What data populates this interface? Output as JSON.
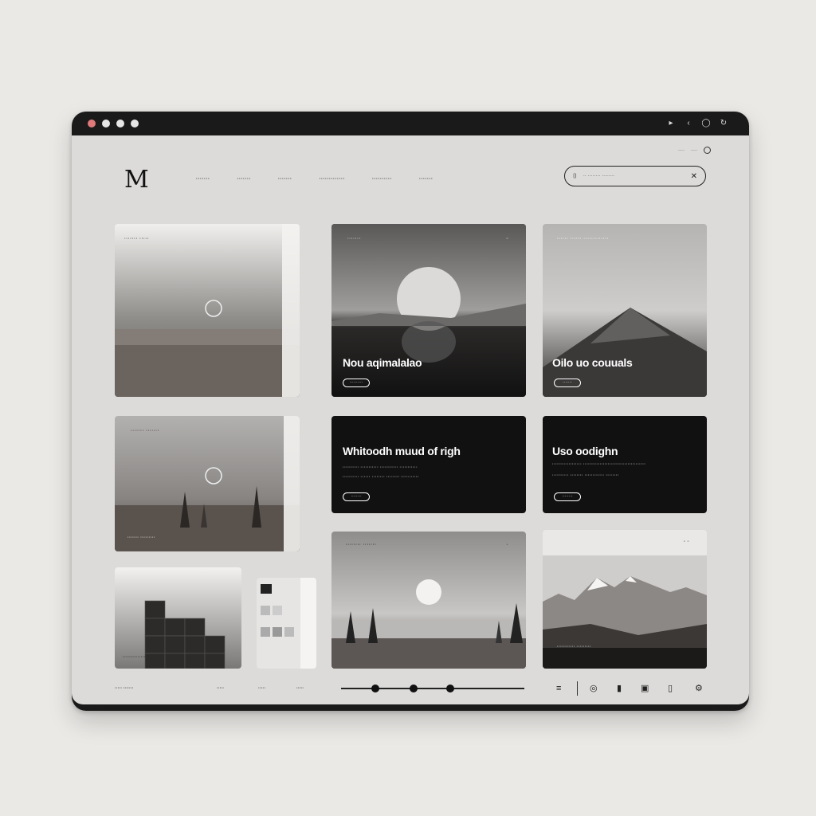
{
  "window": {
    "controls": [
      "close",
      "minimize",
      "maximize"
    ],
    "control_colors": [
      "#e07a7a",
      "#e8e8e8",
      "#e8e8e8"
    ],
    "toolbar_icons": [
      "chevron-icon",
      "back-icon",
      "circle-icon",
      "refresh-icon"
    ]
  },
  "header": {
    "logo": "M",
    "utility": {
      "item1": "····",
      "item2": "····",
      "icon": "info-icon"
    },
    "nav": [
      "·······",
      "·······",
      "·······",
      "·············",
      "··········",
      "·······"
    ],
    "search": {
      "value": "·· ········ ········",
      "icon": "search-mark-icon",
      "clear_icon": "close-icon"
    }
  },
  "cards": {
    "c1": {
      "label": "······· ·····"
    },
    "c2": {
      "label": "·······",
      "title": "Nou aqimalalao",
      "button": "··········"
    },
    "c3": {
      "label": "······ ······ ·············",
      "title": "Oilo uo couuals",
      "button": "·······"
    },
    "c4": {
      "label": "······· ·······",
      "caption": "······· ·········"
    },
    "c5": {
      "title": "Whitoodh muud of righ",
      "line1": "·········· ··········· ··········· ···········",
      "line2": "·········· ······ ········ ········ ···········",
      "button": "········"
    },
    "c6": {
      "title": "Uso oodighn",
      "line1": "·················· ······································",
      "line2": "·········· ········ ············ ········",
      "button": "········"
    },
    "c7": {
      "caption": "··············"
    },
    "c8": {
      "label": "········ ·······"
    },
    "c9": {
      "caption": "··········· ·········"
    }
  },
  "footer": {
    "labels": [
      "····· ·······",
      "·····",
      "·····",
      "·····"
    ],
    "slider_value": 0.3,
    "icons": [
      "menu-icon",
      "target-icon",
      "bar-icon",
      "square-icon",
      "square-outline-icon",
      "gear-icon"
    ]
  },
  "colors": {
    "device": "#1a1a1a",
    "screen": "#dcdbd9",
    "accent": "#111111"
  }
}
